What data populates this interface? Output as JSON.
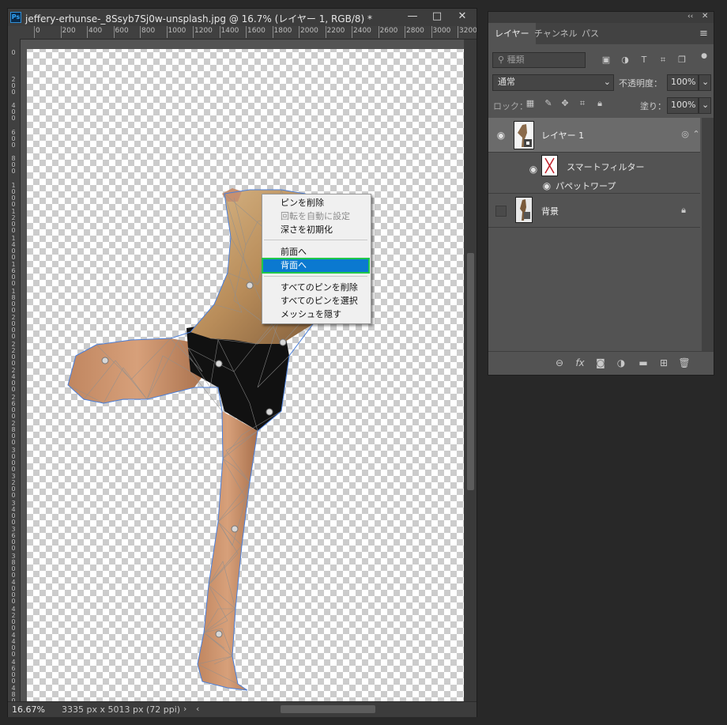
{
  "document": {
    "title": "jeffery-erhunse-_8Ssyb7Sj0w-unsplash.jpg @ 16.7% (レイヤー 1, RGB/8) *",
    "app_icon": "Ps",
    "ruler_ticks": [
      "0",
      "200",
      "400",
      "600",
      "800",
      "1000",
      "1200",
      "1400",
      "1600",
      "1800",
      "2000",
      "2200",
      "2400",
      "2600",
      "2800",
      "3000",
      "3200"
    ],
    "vertical_ruler_ticks": [
      "0",
      "200",
      "400",
      "600",
      "800",
      "1000",
      "1200",
      "1400",
      "1600",
      "1800",
      "2000",
      "2200",
      "2400",
      "2600",
      "2800",
      "3000",
      "3200",
      "3400",
      "3600",
      "3800",
      "4000",
      "4200",
      "4400",
      "4600",
      "4800"
    ],
    "zoom": "16.67%",
    "doc_size": "3335 px x 5013 px (72 ppi)",
    "window_buttons": {
      "minimize": "—",
      "maximize": "□",
      "close": "✕"
    }
  },
  "context_menu": {
    "items": [
      {
        "label": "ピンを削除",
        "enabled": true
      },
      {
        "label": "回転を自動に設定",
        "enabled": false
      },
      {
        "label": "深さを初期化",
        "enabled": true
      },
      {
        "label": "前面へ",
        "enabled": true
      },
      {
        "label": "背面へ",
        "enabled": true,
        "highlighted": true
      },
      {
        "label": "すべてのピンを削除",
        "enabled": true
      },
      {
        "label": "すべてのピンを選択",
        "enabled": true
      },
      {
        "label": "メッシュを隠す",
        "enabled": true
      }
    ]
  },
  "layers_panel": {
    "tabs": [
      "レイヤー",
      "チャンネル",
      "パス"
    ],
    "active_tab": "レイヤー",
    "filter_placeholder": "種類",
    "blend_mode": "通常",
    "opacity_label": "不透明度：",
    "opacity_value": "100%",
    "lock_label": "ロック：",
    "fill_label": "塗り：",
    "fill_value": "100%",
    "layers": [
      {
        "name": "レイヤー 1",
        "visible": true,
        "selected": true,
        "smart_object": true
      },
      {
        "name": "背景",
        "visible": false,
        "locked": true
      }
    ],
    "smart_filters_label": "スマートフィルター",
    "filter_name": "パペットワープ",
    "collapse_icon": "double-chevron-icon",
    "close_icon": "close-icon"
  },
  "colors": {
    "highlight": "#0b79d0",
    "focus_outline": "#22c84a",
    "mesh_outline": "#4a7ed8",
    "panel_bg": "#535353"
  }
}
